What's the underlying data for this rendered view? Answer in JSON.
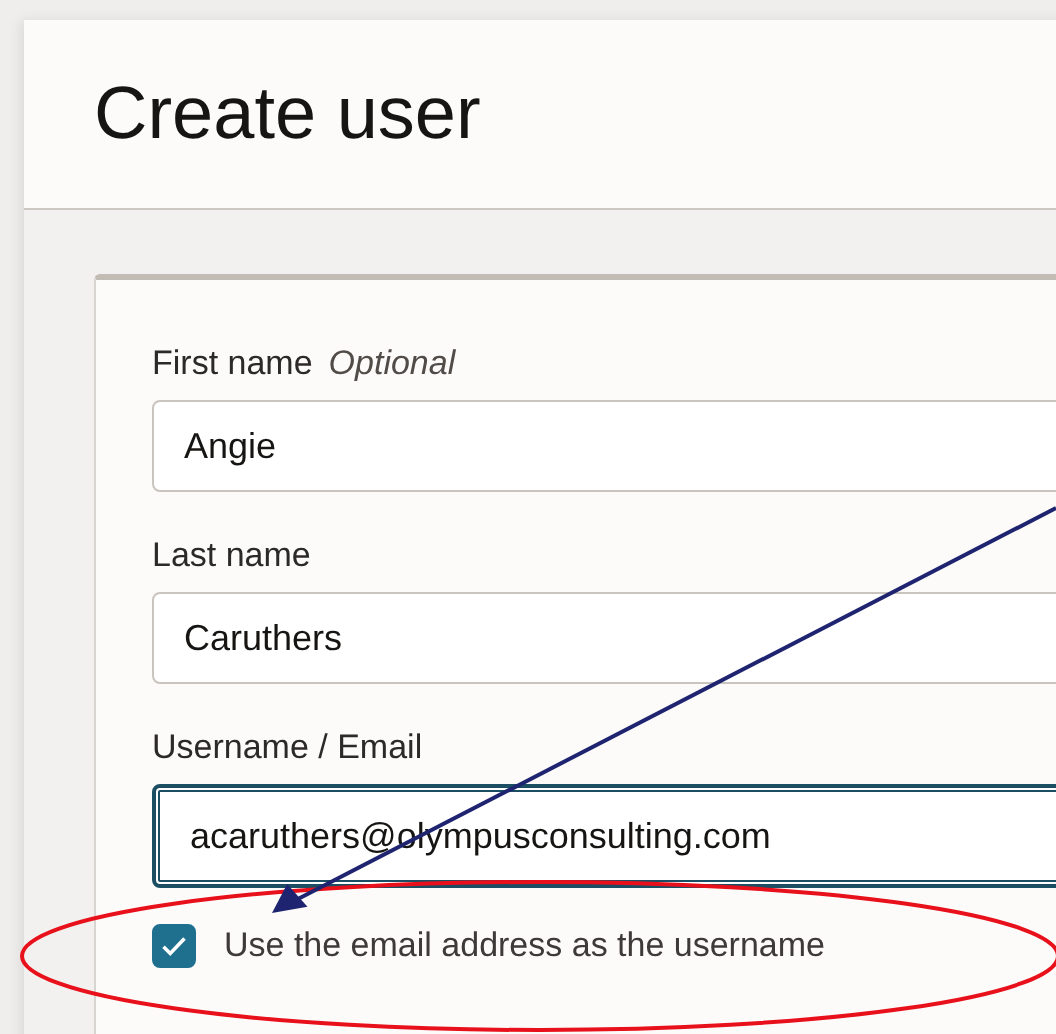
{
  "page": {
    "title": "Create user"
  },
  "fields": [
    {
      "label": "First name",
      "hint": "Optional",
      "value": "Angie",
      "focused": false
    },
    {
      "label": "Last name",
      "value": "Caruthers",
      "focused": false
    },
    {
      "label": "Username / Email",
      "value": "acaruthers@olympusconsulting.com",
      "focused": true
    }
  ],
  "checkbox": {
    "label": "Use the email address as the username",
    "checked": true
  }
}
